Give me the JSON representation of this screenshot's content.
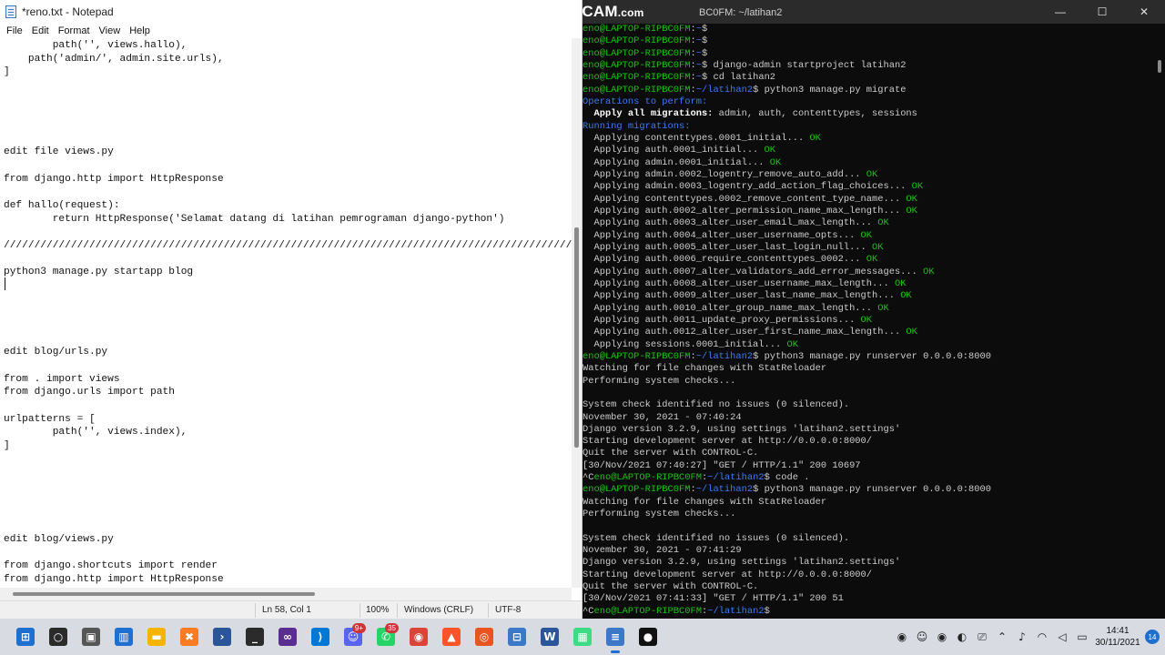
{
  "notepad": {
    "title": "*reno.txt - Notepad",
    "menu": [
      "File",
      "Edit",
      "Format",
      "View",
      "Help"
    ],
    "lines": [
      "        path('', views.hallo),",
      "    path('admin/', admin.site.urls),",
      "]",
      "",
      "",
      "",
      "",
      "",
      "edit file views.py",
      "",
      "from django.http import HttpResponse",
      "",
      "def hallo(request):",
      "        return HttpResponse('Selamat datang di latihan pemrograman django-python')",
      "",
      "////////////////////////////////////////////////////////////////////////////////////////////////////",
      "",
      "python3 manage.py startapp blog",
      "",
      "",
      "",
      "",
      "",
      "edit blog/urls.py",
      "",
      "from . import views",
      "from django.urls import path",
      "",
      "urlpatterns = [",
      "        path('', views.index),",
      "]",
      "",
      "",
      "",
      "",
      "",
      "",
      "edit blog/views.py",
      "",
      "from django.shortcuts import render",
      "from django.http import HttpResponse"
    ],
    "status": {
      "position": "Ln 58, Col 1",
      "zoom": "100%",
      "line_ending": "Windows (CRLF)",
      "encoding": "UTF-8"
    }
  },
  "terminal": {
    "title": "BC0FM: ~/latihan2",
    "watermark_main": "www.BANDICAM",
    "watermark_suffix": ".com",
    "controls": [
      "—",
      "☐",
      "✕"
    ],
    "lines": [
      [
        {
          "c": "p-user",
          "t": "eno@LAPTOP-RIPBC0FM"
        },
        {
          "c": "",
          "t": ":"
        },
        {
          "c": "p-path",
          "t": "~"
        },
        {
          "c": "",
          "t": "$"
        }
      ],
      [
        {
          "c": "p-user",
          "t": "eno@LAPTOP-RIPBC0FM"
        },
        {
          "c": "",
          "t": ":"
        },
        {
          "c": "p-path",
          "t": "~"
        },
        {
          "c": "",
          "t": "$"
        }
      ],
      [
        {
          "c": "p-user",
          "t": "eno@LAPTOP-RIPBC0FM"
        },
        {
          "c": "",
          "t": ":"
        },
        {
          "c": "p-path",
          "t": "~"
        },
        {
          "c": "",
          "t": "$"
        }
      ],
      [
        {
          "c": "p-user",
          "t": "eno@LAPTOP-RIPBC0FM"
        },
        {
          "c": "",
          "t": ":"
        },
        {
          "c": "p-path",
          "t": "~"
        },
        {
          "c": "",
          "t": "$ django-admin startproject latihan2"
        }
      ],
      [
        {
          "c": "p-user",
          "t": "eno@LAPTOP-RIPBC0FM"
        },
        {
          "c": "",
          "t": ":"
        },
        {
          "c": "p-path",
          "t": "~"
        },
        {
          "c": "",
          "t": "$ cd latihan2"
        }
      ],
      [
        {
          "c": "p-user",
          "t": "eno@LAPTOP-RIPBC0FM"
        },
        {
          "c": "",
          "t": ":"
        },
        {
          "c": "p-path",
          "t": "~/latihan2"
        },
        {
          "c": "",
          "t": "$ python3 manage.py migrate"
        }
      ],
      [
        {
          "c": "t-blue",
          "t": "Operations to perform:"
        }
      ],
      [
        {
          "c": "t-bold",
          "t": "  Apply all migrations:"
        },
        {
          "c": "",
          "t": " admin, auth, contenttypes, sessions"
        }
      ],
      [
        {
          "c": "t-blue",
          "t": "Running migrations:"
        }
      ],
      [
        {
          "c": "",
          "t": "  Applying contenttypes.0001_initial..."
        },
        {
          "c": "t-green",
          "t": " OK"
        }
      ],
      [
        {
          "c": "",
          "t": "  Applying auth.0001_initial..."
        },
        {
          "c": "t-green",
          "t": " OK"
        }
      ],
      [
        {
          "c": "",
          "t": "  Applying admin.0001_initial..."
        },
        {
          "c": "t-green",
          "t": " OK"
        }
      ],
      [
        {
          "c": "",
          "t": "  Applying admin.0002_logentry_remove_auto_add..."
        },
        {
          "c": "t-green",
          "t": " OK"
        }
      ],
      [
        {
          "c": "",
          "t": "  Applying admin.0003_logentry_add_action_flag_choices..."
        },
        {
          "c": "t-green",
          "t": " OK"
        }
      ],
      [
        {
          "c": "",
          "t": "  Applying contenttypes.0002_remove_content_type_name..."
        },
        {
          "c": "t-green",
          "t": " OK"
        }
      ],
      [
        {
          "c": "",
          "t": "  Applying auth.0002_alter_permission_name_max_length..."
        },
        {
          "c": "t-green",
          "t": " OK"
        }
      ],
      [
        {
          "c": "",
          "t": "  Applying auth.0003_alter_user_email_max_length..."
        },
        {
          "c": "t-green",
          "t": " OK"
        }
      ],
      [
        {
          "c": "",
          "t": "  Applying auth.0004_alter_user_username_opts..."
        },
        {
          "c": "t-green",
          "t": " OK"
        }
      ],
      [
        {
          "c": "",
          "t": "  Applying auth.0005_alter_user_last_login_null..."
        },
        {
          "c": "t-green",
          "t": " OK"
        }
      ],
      [
        {
          "c": "",
          "t": "  Applying auth.0006_require_contenttypes_0002..."
        },
        {
          "c": "t-green",
          "t": " OK"
        }
      ],
      [
        {
          "c": "",
          "t": "  Applying auth.0007_alter_validators_add_error_messages..."
        },
        {
          "c": "t-green",
          "t": " OK"
        }
      ],
      [
        {
          "c": "",
          "t": "  Applying auth.0008_alter_user_username_max_length..."
        },
        {
          "c": "t-green",
          "t": " OK"
        }
      ],
      [
        {
          "c": "",
          "t": "  Applying auth.0009_alter_user_last_name_max_length..."
        },
        {
          "c": "t-green",
          "t": " OK"
        }
      ],
      [
        {
          "c": "",
          "t": "  Applying auth.0010_alter_group_name_max_length..."
        },
        {
          "c": "t-green",
          "t": " OK"
        }
      ],
      [
        {
          "c": "",
          "t": "  Applying auth.0011_update_proxy_permissions..."
        },
        {
          "c": "t-green",
          "t": " OK"
        }
      ],
      [
        {
          "c": "",
          "t": "  Applying auth.0012_alter_user_first_name_max_length..."
        },
        {
          "c": "t-green",
          "t": " OK"
        }
      ],
      [
        {
          "c": "",
          "t": "  Applying sessions.0001_initial..."
        },
        {
          "c": "t-green",
          "t": " OK"
        }
      ],
      [
        {
          "c": "p-user",
          "t": "eno@LAPTOP-RIPBC0FM"
        },
        {
          "c": "",
          "t": ":"
        },
        {
          "c": "p-path",
          "t": "~/latihan2"
        },
        {
          "c": "",
          "t": "$ python3 manage.py runserver 0.0.0.0:8000"
        }
      ],
      [
        {
          "c": "",
          "t": "Watching for file changes with StatReloader"
        }
      ],
      [
        {
          "c": "",
          "t": "Performing system checks..."
        }
      ],
      [
        {
          "c": "",
          "t": ""
        }
      ],
      [
        {
          "c": "",
          "t": "System check identified no issues (0 silenced)."
        }
      ],
      [
        {
          "c": "",
          "t": "November 30, 2021 - 07:40:24"
        }
      ],
      [
        {
          "c": "",
          "t": "Django version 3.2.9, using settings 'latihan2.settings'"
        }
      ],
      [
        {
          "c": "",
          "t": "Starting development server at http://0.0.0.0:8000/"
        }
      ],
      [
        {
          "c": "",
          "t": "Quit the server with CONTROL-C."
        }
      ],
      [
        {
          "c": "",
          "t": "[30/Nov/2021 07:40:27] \"GET / HTTP/1.1\" 200 10697"
        }
      ],
      [
        {
          "c": "",
          "t": "^C"
        },
        {
          "c": "p-user",
          "t": "eno@LAPTOP-RIPBC0FM"
        },
        {
          "c": "",
          "t": ":"
        },
        {
          "c": "p-path",
          "t": "~/latihan2"
        },
        {
          "c": "",
          "t": "$ code ."
        }
      ],
      [
        {
          "c": "p-user",
          "t": "eno@LAPTOP-RIPBC0FM"
        },
        {
          "c": "",
          "t": ":"
        },
        {
          "c": "p-path",
          "t": "~/latihan2"
        },
        {
          "c": "",
          "t": "$ python3 manage.py runserver 0.0.0.0:8000"
        }
      ],
      [
        {
          "c": "",
          "t": "Watching for file changes with StatReloader"
        }
      ],
      [
        {
          "c": "",
          "t": "Performing system checks..."
        }
      ],
      [
        {
          "c": "",
          "t": ""
        }
      ],
      [
        {
          "c": "",
          "t": "System check identified no issues (0 silenced)."
        }
      ],
      [
        {
          "c": "",
          "t": "November 30, 2021 - 07:41:29"
        }
      ],
      [
        {
          "c": "",
          "t": "Django version 3.2.9, using settings 'latihan2.settings'"
        }
      ],
      [
        {
          "c": "",
          "t": "Starting development server at http://0.0.0.0:8000/"
        }
      ],
      [
        {
          "c": "",
          "t": "Quit the server with CONTROL-C."
        }
      ],
      [
        {
          "c": "",
          "t": "[30/Nov/2021 07:41:33] \"GET / HTTP/1.1\" 200 51"
        }
      ],
      [
        {
          "c": "",
          "t": "^C"
        },
        {
          "c": "p-user",
          "t": "eno@LAPTOP-RIPBC0FM"
        },
        {
          "c": "",
          "t": ":"
        },
        {
          "c": "p-path",
          "t": "~/latihan2"
        },
        {
          "c": "",
          "t": "$"
        }
      ]
    ]
  },
  "taskbar": {
    "apps": [
      {
        "name": "start-button",
        "icon": "windows-logo-icon",
        "glyph": "⊞",
        "bg": "#1f6fd1",
        "active": false
      },
      {
        "name": "search-button",
        "icon": "search-icon",
        "glyph": "○",
        "bg": "#2b2b2b",
        "active": false
      },
      {
        "name": "task-view-button",
        "icon": "task-view-icon",
        "glyph": "▣",
        "bg": "#555555",
        "active": false
      },
      {
        "name": "widgets-button",
        "icon": "widgets-icon",
        "glyph": "▥",
        "bg": "#1f6fd1",
        "active": false
      },
      {
        "name": "file-explorer-app",
        "icon": "folder-icon",
        "glyph": "▬",
        "bg": "#f4b400",
        "active": false
      },
      {
        "name": "xampp-app",
        "icon": "xampp-icon",
        "glyph": "✖",
        "bg": "#fb7a24",
        "active": false
      },
      {
        "name": "powershell-app",
        "icon": "powershell-icon",
        "glyph": "›",
        "bg": "#2a5699",
        "active": false
      },
      {
        "name": "terminal-app",
        "icon": "terminal-icon",
        "glyph": "_",
        "bg": "#2b2b2b",
        "active": false
      },
      {
        "name": "vs-app",
        "icon": "visual-studio-icon",
        "glyph": "∞",
        "bg": "#5c2d91",
        "active": false
      },
      {
        "name": "vscode-app",
        "icon": "vscode-icon",
        "glyph": "⟩",
        "bg": "#0078d4",
        "active": false
      },
      {
        "name": "discord-app",
        "icon": "discord-icon",
        "glyph": "☺",
        "bg": "#5865f2",
        "active": false,
        "badge": "9+"
      },
      {
        "name": "whatsapp-app",
        "icon": "whatsapp-icon",
        "glyph": "✆",
        "bg": "#25d366",
        "active": false,
        "badge": "35"
      },
      {
        "name": "chrome-app",
        "icon": "chrome-icon",
        "glyph": "◉",
        "bg": "#db4437",
        "active": false
      },
      {
        "name": "brave-app",
        "icon": "brave-icon",
        "glyph": "▲",
        "bg": "#fb542b",
        "active": false
      },
      {
        "name": "ubuntu-app",
        "icon": "ubuntu-icon",
        "glyph": "◎",
        "bg": "#e95420",
        "active": false
      },
      {
        "name": "network-tool-app",
        "icon": "network-icon",
        "glyph": "⊟",
        "bg": "#3c78c8",
        "active": false
      },
      {
        "name": "word-app",
        "icon": "word-icon",
        "glyph": "W",
        "bg": "#2b579a",
        "active": false
      },
      {
        "name": "android-app",
        "icon": "android-icon",
        "glyph": "▦",
        "bg": "#3ddc84",
        "active": false
      },
      {
        "name": "notepad-app",
        "icon": "notepad-icon",
        "glyph": "≡",
        "bg": "#3c78c8",
        "active": true
      },
      {
        "name": "bandicam-app",
        "icon": "record-icon",
        "glyph": "●",
        "bg": "#111111",
        "active": false
      }
    ],
    "tray": [
      {
        "name": "record-tray-icon",
        "glyph": "◉"
      },
      {
        "name": "discord-tray-icon",
        "glyph": "☺"
      },
      {
        "name": "chrome-tray-icon",
        "glyph": "◉"
      },
      {
        "name": "shield-tray-icon",
        "glyph": "◐"
      },
      {
        "name": "usb-tray-icon",
        "glyph": "⎚"
      },
      {
        "name": "chevron-up-icon",
        "glyph": "⌃"
      },
      {
        "name": "microphone-icon",
        "glyph": "♪"
      },
      {
        "name": "wifi-icon",
        "glyph": "◠"
      },
      {
        "name": "speaker-icon",
        "glyph": "◁"
      },
      {
        "name": "battery-icon",
        "glyph": "▭"
      }
    ],
    "clock": {
      "time": "14:41",
      "date": "30/11/2021"
    },
    "notifications": "14"
  }
}
